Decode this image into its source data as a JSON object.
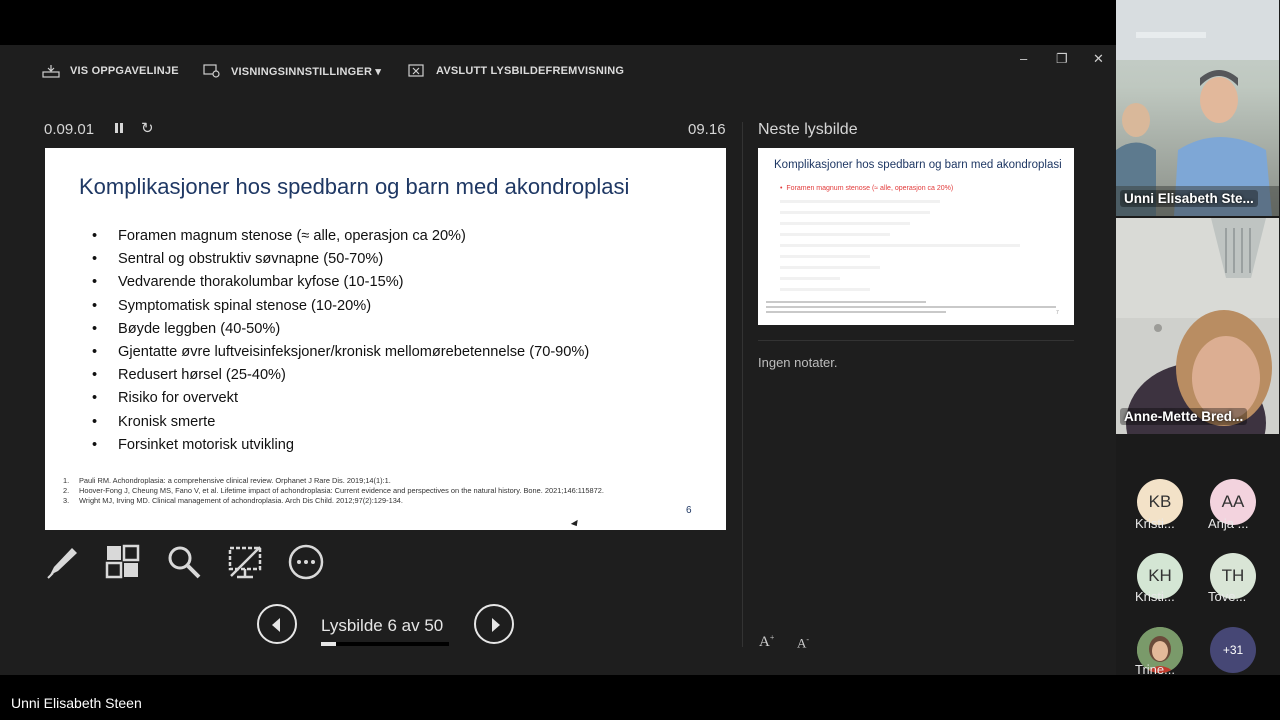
{
  "toolbar": {
    "taskbar_label": "VIS OPPGAVELINJE",
    "display_settings_label": "VISNINGSINNSTILLINGER ▾",
    "end_show_label": "AVSLUTT LYSBILDEFREMVISNING",
    "minimize": "–",
    "restore": "❐",
    "close": "✕"
  },
  "timer": {
    "elapsed": "0.09.01",
    "clock": "09.16",
    "reset_glyph": "↻"
  },
  "slide": {
    "title": "Komplikasjoner hos spedbarn og barn med akondroplasi",
    "bullets": [
      "Foramen magnum stenose (≈ alle, operasjon ca 20%)",
      "Sentral og obstruktiv søvnapne (50-70%)",
      "Vedvarende thorakolumbar kyfose (10-15%)",
      "Symptomatisk spinal stenose (10-20%)",
      "Bøyde leggben (40-50%)",
      "Gjentatte øvre luftveisinfeksjoner/kronisk mellomørebetennelse (70-90%)",
      "Redusert hørsel (25-40%)",
      "Risiko for overvekt",
      "Kronisk smerte",
      "Forsinket motorisk utvikling"
    ],
    "refs": [
      {
        "n": "1.",
        "text": "Pauli RM. Achondroplasia: a comprehensive clinical review. Orphanet J Rare Dis. 2019;14(1):1."
      },
      {
        "n": "2.",
        "text": "Hoover-Fong J, Cheung MS, Fano V, et al. Lifetime impact of achondroplasia: Current evidence and perspectives on the natural history. Bone. 2021;146:115872."
      },
      {
        "n": "3.",
        "text": "Wright MJ, Irving MD. Clinical management of achondroplasia. Arch Dis Child. 2012;97(2):129-134."
      }
    ],
    "number": "6"
  },
  "tools": {
    "pen": "pen-icon",
    "all_slides": "all-slides-icon",
    "zoom": "magnifier-icon",
    "black_screen": "black-screen-icon",
    "more": "more-options-icon"
  },
  "navigation": {
    "counter": "Lysbilde 6 av 50",
    "progress": 0.12
  },
  "next_slide": {
    "label": "Neste lysbilde",
    "title": "Komplikasjoner hos spedbarn og barn med akondroplasi",
    "first_bullet": "Foramen magnum stenose (≈ alle, operasjon ca 20%)"
  },
  "notes": {
    "text": "Ingen notater."
  },
  "font_controls": {
    "increase": "A",
    "decrease": "A"
  },
  "participants": {
    "video": [
      {
        "name": "Unni Elisabeth Ste..."
      },
      {
        "name": "Anne-Mette Bred..."
      }
    ],
    "avatars": [
      {
        "initials": "KB",
        "name": "Kristi...",
        "color": "#f3e2c8"
      },
      {
        "initials": "AA",
        "name": "Anja ...",
        "color": "#f3d3de"
      },
      {
        "initials": "KH",
        "name": "Kristi...",
        "color": "#d4e6d4"
      },
      {
        "initials": "TH",
        "name": "Tove...",
        "color": "#d9e5d6"
      },
      {
        "initials": "",
        "name": "Trine...",
        "color": "#7a9a6a"
      },
      {
        "initials": "+31",
        "name": "",
        "color": "#464775"
      }
    ]
  },
  "presenter": {
    "name": "Unni Elisabeth Steen"
  }
}
